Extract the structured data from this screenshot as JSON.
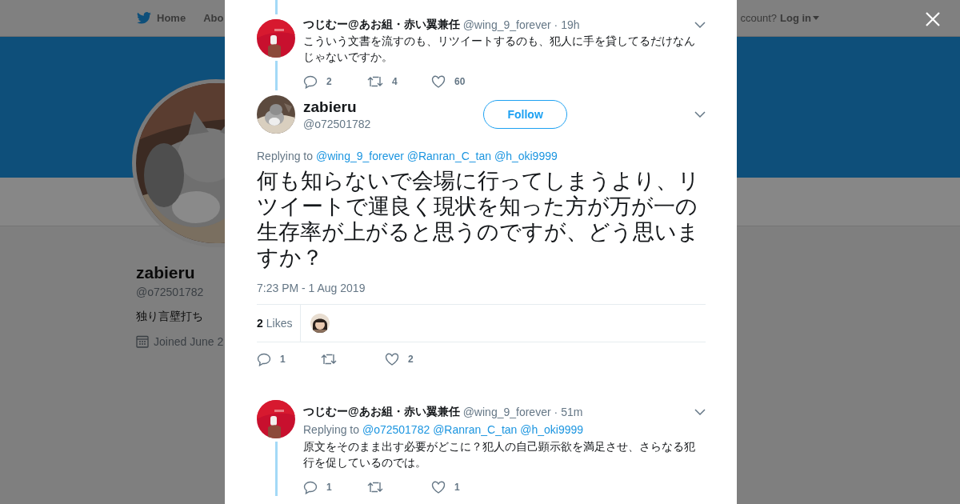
{
  "top_nav": {
    "items": [
      {
        "label": "Home"
      },
      {
        "label": "Abo"
      }
    ],
    "account_prompt": "ccount?",
    "login": "Log in"
  },
  "profile": {
    "name": "zabieru",
    "handle": "@o72501782",
    "bio": "独り言壁打ち",
    "joined": "Joined June 2"
  },
  "tweets": [
    {
      "kind": "thread",
      "name": "つじむー@あお組・赤い翼兼任",
      "handle": "@wing_9_forever",
      "time": "· 19h",
      "text": "こういう文書を流すのも、リツイートするのも、犯人に手を貸してるだけなんじゃないですか。",
      "actions": [
        {
          "kind": "reply",
          "count": "2"
        },
        {
          "kind": "retweet",
          "count": "4"
        },
        {
          "kind": "like",
          "count": "60"
        }
      ]
    },
    {
      "kind": "focused",
      "name": "zabieru",
      "handle": "@o72501782",
      "follow": "Follow",
      "replying_prefix": "Replying to",
      "mentions": [
        "@wing_9_forever",
        "@Ranran_C_tan",
        "@h_oki9999"
      ],
      "text": "何も知らないで会場に行ってしまうより、リツイートで運良く現状を知った方が万が一の生存率が上がると思うのですが、どう思いますか？",
      "timestamp": "7:23 PM - 1 Aug 2019",
      "likes_count": "2",
      "likes_label": "Likes",
      "actions": [
        {
          "kind": "reply",
          "count": "1"
        },
        {
          "kind": "retweet"
        },
        {
          "kind": "like",
          "count": "2"
        }
      ]
    },
    {
      "kind": "thread",
      "name": "つじむー@あお組・赤い翼兼任",
      "handle": "@wing_9_forever",
      "time": "· 51m",
      "replying_prefix": "Replying to",
      "mentions": [
        "@o72501782",
        "@Ranran_C_tan",
        "@h_oki9999"
      ],
      "text": "原文をそのまま出す必要がどこに？犯人の自己顕示欲を満足させ、さらなる犯行を促しているのでは。",
      "actions": [
        {
          "kind": "reply",
          "count": "1"
        },
        {
          "kind": "retweet"
        },
        {
          "kind": "like",
          "count": "1"
        }
      ]
    }
  ]
}
